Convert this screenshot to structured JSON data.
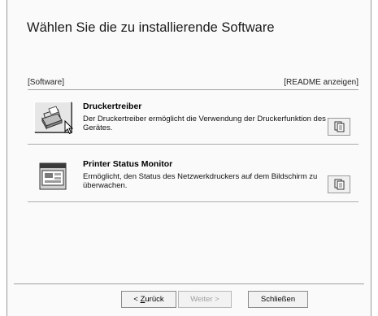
{
  "dialog": {
    "title": "Wählen Sie die zu installierende Software"
  },
  "section": {
    "left_label": "[Software]",
    "right_label": "[README anzeigen]"
  },
  "items": [
    {
      "title": "Druckertreiber",
      "description": "Der Druckertreiber ermöglicht die Verwendung der Druckerfunktion des Gerätes.",
      "icon": "printer-icon"
    },
    {
      "title": "Printer Status Monitor",
      "description": "Ermöglicht, den Status des Netzwerkdruckers auf dem Bildschirm zu überwachen.",
      "icon": "status-monitor-icon"
    }
  ],
  "footer": {
    "back_prefix": "< ",
    "back_underlined": "Z",
    "back_rest": "urück",
    "next_label": "Weiter >",
    "close_label": "Schließen"
  }
}
